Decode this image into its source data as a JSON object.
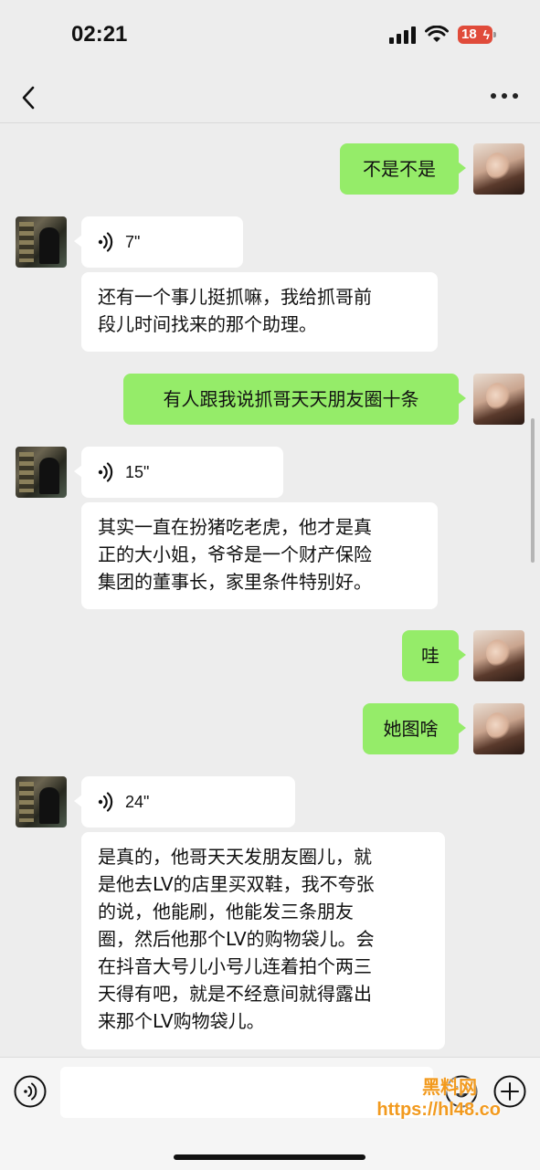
{
  "status_bar": {
    "time": "02:21",
    "battery": "18"
  },
  "nav": {
    "back_icon": "chevron-left-icon",
    "more_icon": "ellipsis-icon"
  },
  "messages": [
    {
      "from": "me",
      "type": "text",
      "text": "不是不是"
    },
    {
      "from": "them",
      "type": "voice",
      "duration": "7\""
    },
    {
      "from": "them",
      "type": "text",
      "lines": [
        "还有一个事儿挺抓嘛，我给抓哥前",
        "段儿时间找来的那个助理。"
      ]
    },
    {
      "from": "me",
      "type": "text",
      "text": "有人跟我说抓哥天天朋友圈十条"
    },
    {
      "from": "them",
      "type": "voice",
      "duration": "15\""
    },
    {
      "from": "them",
      "type": "text",
      "lines": [
        "其实一直在扮猪吃老虎，他才是真",
        "正的大小姐，爷爷是一个财产保险",
        "集团的董事长，家里条件特别好。"
      ]
    },
    {
      "from": "me",
      "type": "text",
      "text": "哇"
    },
    {
      "from": "me",
      "type": "text",
      "text": "她图啥"
    },
    {
      "from": "them",
      "type": "voice",
      "duration": "24\""
    },
    {
      "from": "them",
      "type": "text",
      "lines": [
        "是真的，他哥天天发朋友圈儿，就",
        "是他去LV的店里买双鞋，我不夸张",
        "的说，他能刷，他能发三条朋友",
        "圈，然后他那个LV的购物袋儿。会",
        "在抖音大号儿小号儿连着拍个两三",
        "天得有吧，就是不经意间就得露出",
        "来那个LV购物袋儿。"
      ]
    }
  ],
  "input_bar": {
    "voice_icon": "voice-input-icon",
    "emoji_icon": "emoji-icon",
    "plus_icon": "plus-icon"
  },
  "watermark": {
    "line1": "黑料网",
    "line2": "https://hl48.co"
  },
  "colors": {
    "out_bubble": "#95ec69",
    "in_bubble": "#ffffff",
    "background": "#ededed"
  }
}
